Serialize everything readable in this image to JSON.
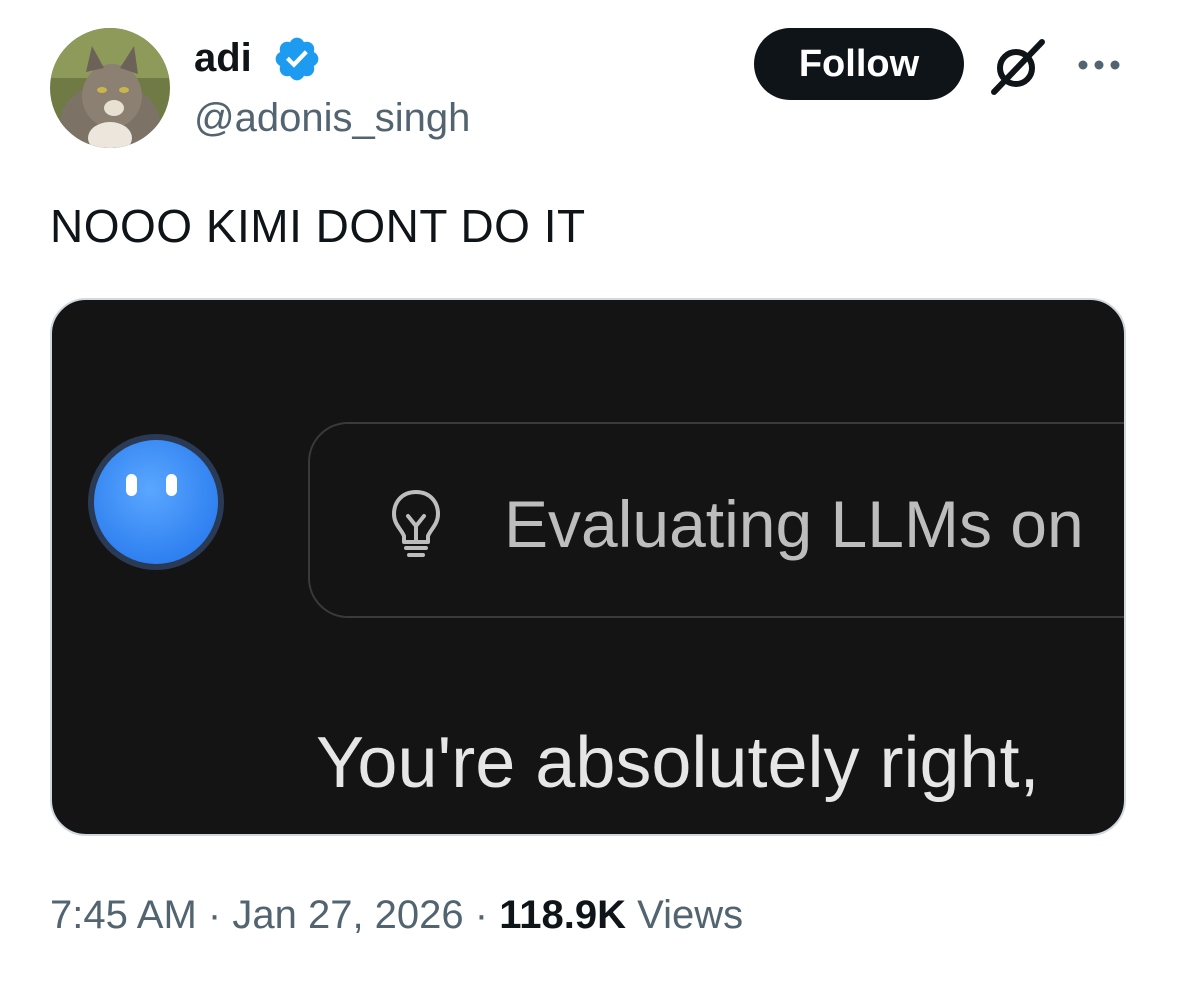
{
  "author": {
    "name": "adi",
    "handle": "@adonis_singh",
    "verified_color": "#1d9bf0"
  },
  "header": {
    "follow_label": "Follow",
    "icons": [
      "grok-icon",
      "more-icon"
    ]
  },
  "tweet": {
    "text": "NOOO KIMI DONT DO IT"
  },
  "media": {
    "thinking_label": "Evaluating LLMs on",
    "response_text": "You're absolutely right,",
    "bot_color": "#3d8ef7"
  },
  "meta": {
    "time": "7:45 AM",
    "separator": "·",
    "date": "Jan 27, 2026",
    "views_count": "118.9K",
    "views_label": "Views"
  }
}
